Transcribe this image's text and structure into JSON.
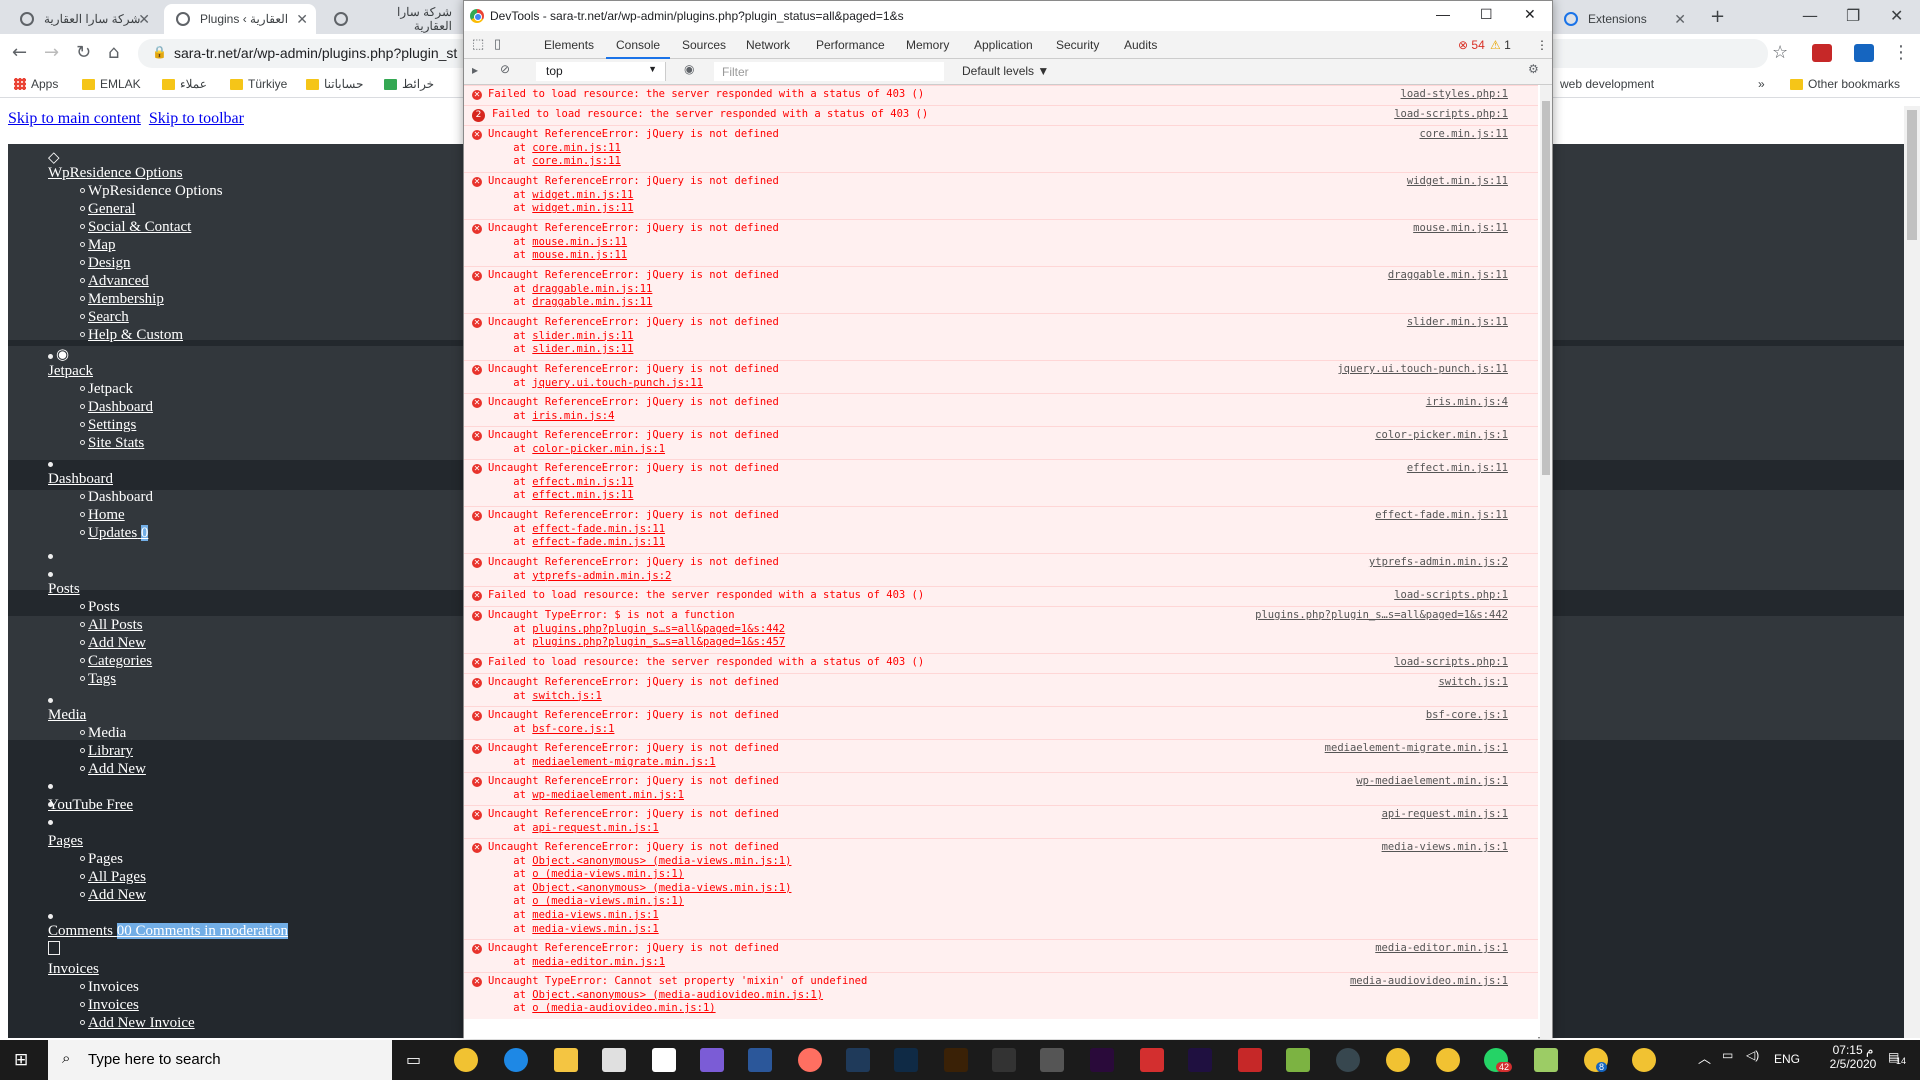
{
  "browser": {
    "tabs": [
      {
        "title": "شركة سارا العقارية"
      },
      {
        "title": "Plugins ‹ العقارية"
      },
      {
        "title": "شركة سارا العقارية"
      },
      {
        "title": "Extensions"
      }
    ],
    "url": "sara-tr.net/ar/wp-admin/plugins.php?plugin_st",
    "bookmarks": [
      "Apps",
      "EMLAK",
      "عملاء",
      "Türkiye",
      "حساباتنا",
      "خرائط"
    ],
    "bookmarks_right": [
      "web development",
      "Other bookmarks"
    ],
    "overflow": "»"
  },
  "page": {
    "skip_main": "Skip to main content",
    "skip_toolbar": "Skip to toolbar",
    "menu": [
      {
        "label": "WpResidence Options",
        "items": [
          "WpResidence Options",
          "General",
          "Social & Contact",
          "Map",
          "Design",
          "Advanced",
          "Membership",
          "Search",
          "Help & Custom"
        ]
      },
      {
        "label": "Jetpack",
        "items": [
          "Jetpack",
          "Dashboard",
          "Settings",
          "Site Stats"
        ]
      },
      {
        "label": "Dashboard",
        "items": [
          "Dashboard",
          "Home",
          "Updates"
        ],
        "updates_count": "0"
      },
      {
        "label": "Posts",
        "items": [
          "Posts",
          "All Posts",
          "Add New",
          "Categories",
          "Tags"
        ]
      },
      {
        "label": "Media",
        "items": [
          "Media",
          "Library",
          "Add New"
        ]
      },
      {
        "label": "YouTube Free",
        "items": []
      },
      {
        "label": "Pages",
        "items": [
          "Pages",
          "All Pages",
          "Add New"
        ]
      },
      {
        "label": "Comments",
        "badge": "00 Comments in moderation",
        "items": []
      },
      {
        "label": "Invoices",
        "items": [
          "Invoices",
          "Invoices",
          "Add New Invoice"
        ]
      }
    ]
  },
  "devtools": {
    "title": "DevTools - sara-tr.net/ar/wp-admin/plugins.php?plugin_status=all&paged=1&s",
    "tabs": [
      "Elements",
      "Console",
      "Sources",
      "Network",
      "Performance",
      "Memory",
      "Application",
      "Security",
      "Audits"
    ],
    "active_tab": "Console",
    "errors_count": "54",
    "warnings_count": "1",
    "context": "top",
    "filter_placeholder": "Filter",
    "levels": "Default levels ▼",
    "messages": [
      {
        "text": "Failed to load resource: the server responded with a status of 403 ()",
        "source": "load-styles.php:1",
        "stack": []
      },
      {
        "text": "Failed to load resource: the server responded with a status of 403 ()",
        "source": "load-scripts.php:1",
        "stack": [],
        "count": "2"
      },
      {
        "text": "Uncaught ReferenceError: jQuery is not defined",
        "source": "core.min.js:11",
        "stack": [
          "core.min.js:11",
          "core.min.js:11"
        ]
      },
      {
        "text": "Uncaught ReferenceError: jQuery is not defined",
        "source": "widget.min.js:11",
        "stack": [
          "widget.min.js:11",
          "widget.min.js:11"
        ]
      },
      {
        "text": "Uncaught ReferenceError: jQuery is not defined",
        "source": "mouse.min.js:11",
        "stack": [
          "mouse.min.js:11",
          "mouse.min.js:11"
        ]
      },
      {
        "text": "Uncaught ReferenceError: jQuery is not defined",
        "source": "draggable.min.js:11",
        "stack": [
          "draggable.min.js:11",
          "draggable.min.js:11"
        ]
      },
      {
        "text": "Uncaught ReferenceError: jQuery is not defined",
        "source": "slider.min.js:11",
        "stack": [
          "slider.min.js:11",
          "slider.min.js:11"
        ]
      },
      {
        "text": "Uncaught ReferenceError: jQuery is not defined",
        "source": "jquery.ui.touch-punch.js:11",
        "stack": [
          "jquery.ui.touch-punch.js:11"
        ]
      },
      {
        "text": "Uncaught ReferenceError: jQuery is not defined",
        "source": "iris.min.js:4",
        "stack": [
          "iris.min.js:4"
        ]
      },
      {
        "text": "Uncaught ReferenceError: jQuery is not defined",
        "source": "color-picker.min.js:1",
        "stack": [
          "color-picker.min.js:1"
        ]
      },
      {
        "text": "Uncaught ReferenceError: jQuery is not defined",
        "source": "effect.min.js:11",
        "stack": [
          "effect.min.js:11",
          "effect.min.js:11"
        ]
      },
      {
        "text": "Uncaught ReferenceError: jQuery is not defined",
        "source": "effect-fade.min.js:11",
        "stack": [
          "effect-fade.min.js:11",
          "effect-fade.min.js:11"
        ]
      },
      {
        "text": "Uncaught ReferenceError: jQuery is not defined",
        "source": "ytprefs-admin.min.js:2",
        "stack": [
          "ytprefs-admin.min.js:2"
        ]
      },
      {
        "text": "Failed to load resource: the server responded with a status of 403 ()",
        "source": "load-scripts.php:1",
        "stack": []
      },
      {
        "text": "Uncaught TypeError: $ is not a function",
        "source": "plugins.php?plugin_s…s=all&paged=1&s:442",
        "stack": [
          "plugins.php?plugin_s…s=all&paged=1&s:442",
          "plugins.php?plugin_s…s=all&paged=1&s:457"
        ]
      },
      {
        "text": "Failed to load resource: the server responded with a status of 403 ()",
        "source": "load-scripts.php:1",
        "stack": []
      },
      {
        "text": "Uncaught ReferenceError: jQuery is not defined",
        "source": "switch.js:1",
        "stack": [
          "switch.js:1"
        ]
      },
      {
        "text": "Uncaught ReferenceError: jQuery is not defined",
        "source": "bsf-core.js:1",
        "stack": [
          "bsf-core.js:1"
        ]
      },
      {
        "text": "Uncaught ReferenceError: jQuery is not defined",
        "source": "mediaelement-migrate.min.js:1",
        "stack": [
          "mediaelement-migrate.min.js:1"
        ]
      },
      {
        "text": "Uncaught ReferenceError: jQuery is not defined",
        "source": "wp-mediaelement.min.js:1",
        "stack": [
          "wp-mediaelement.min.js:1"
        ]
      },
      {
        "text": "Uncaught ReferenceError: jQuery is not defined",
        "source": "api-request.min.js:1",
        "stack": [
          "api-request.min.js:1"
        ]
      },
      {
        "text": "Uncaught ReferenceError: jQuery is not defined",
        "source": "media-views.min.js:1",
        "stack": [
          "Object.<anonymous> (media-views.min.js:1)",
          "o (media-views.min.js:1)",
          "Object.<anonymous> (media-views.min.js:1)",
          "o (media-views.min.js:1)",
          "media-views.min.js:1",
          "media-views.min.js:1"
        ]
      },
      {
        "text": "Uncaught ReferenceError: jQuery is not defined",
        "source": "media-editor.min.js:1",
        "stack": [
          "media-editor.min.js:1"
        ]
      },
      {
        "text": "Uncaught TypeError: Cannot set property 'mixin' of undefined",
        "source": "media-audiovideo.min.js:1",
        "stack": [
          "Object.<anonymous> (media-audiovideo.min.js:1)",
          "o (media-audiovideo.min.js:1)"
        ]
      }
    ]
  },
  "taskbar": {
    "search_placeholder": "Type here to search",
    "time": "07:15 م",
    "date": "2/5/2020",
    "lang": "ENG",
    "notifications": "14",
    "whatsapp_badge": "42",
    "badge_8": "8"
  }
}
